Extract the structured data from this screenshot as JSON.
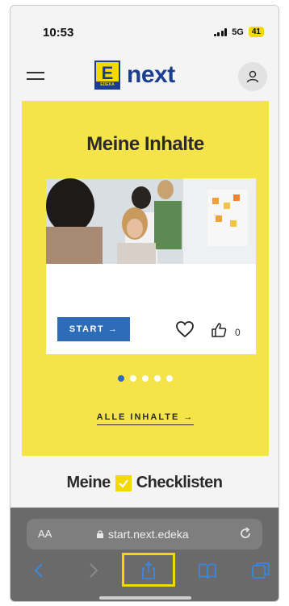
{
  "status": {
    "time": "10:53",
    "network": "5G",
    "battery": "41"
  },
  "header": {
    "logo_letter": "E",
    "logo_sub": "EDEKA",
    "logo_text": "next"
  },
  "content": {
    "title": "Meine Inhalte",
    "card": {
      "start_label": "START →",
      "like_count": "0"
    },
    "carousel": {
      "count": 5,
      "active_index": 0
    },
    "all_link": "ALLE INHALTE →"
  },
  "checklists": {
    "title_left": "Meine",
    "title_right": "Checklisten"
  },
  "browser": {
    "aa_label": "AA",
    "url": "start.next.edeka"
  },
  "colors": {
    "brand_yellow": "#f5e34a",
    "brand_blue": "#2d6cb8",
    "browser_gray": "#6a6a6a"
  },
  "icons": [
    "menu-icon",
    "profile-icon",
    "heart-icon",
    "thumbs-up-icon",
    "lock-icon",
    "reload-icon",
    "back-icon",
    "forward-icon",
    "share-icon",
    "bookmarks-icon",
    "tabs-icon"
  ]
}
